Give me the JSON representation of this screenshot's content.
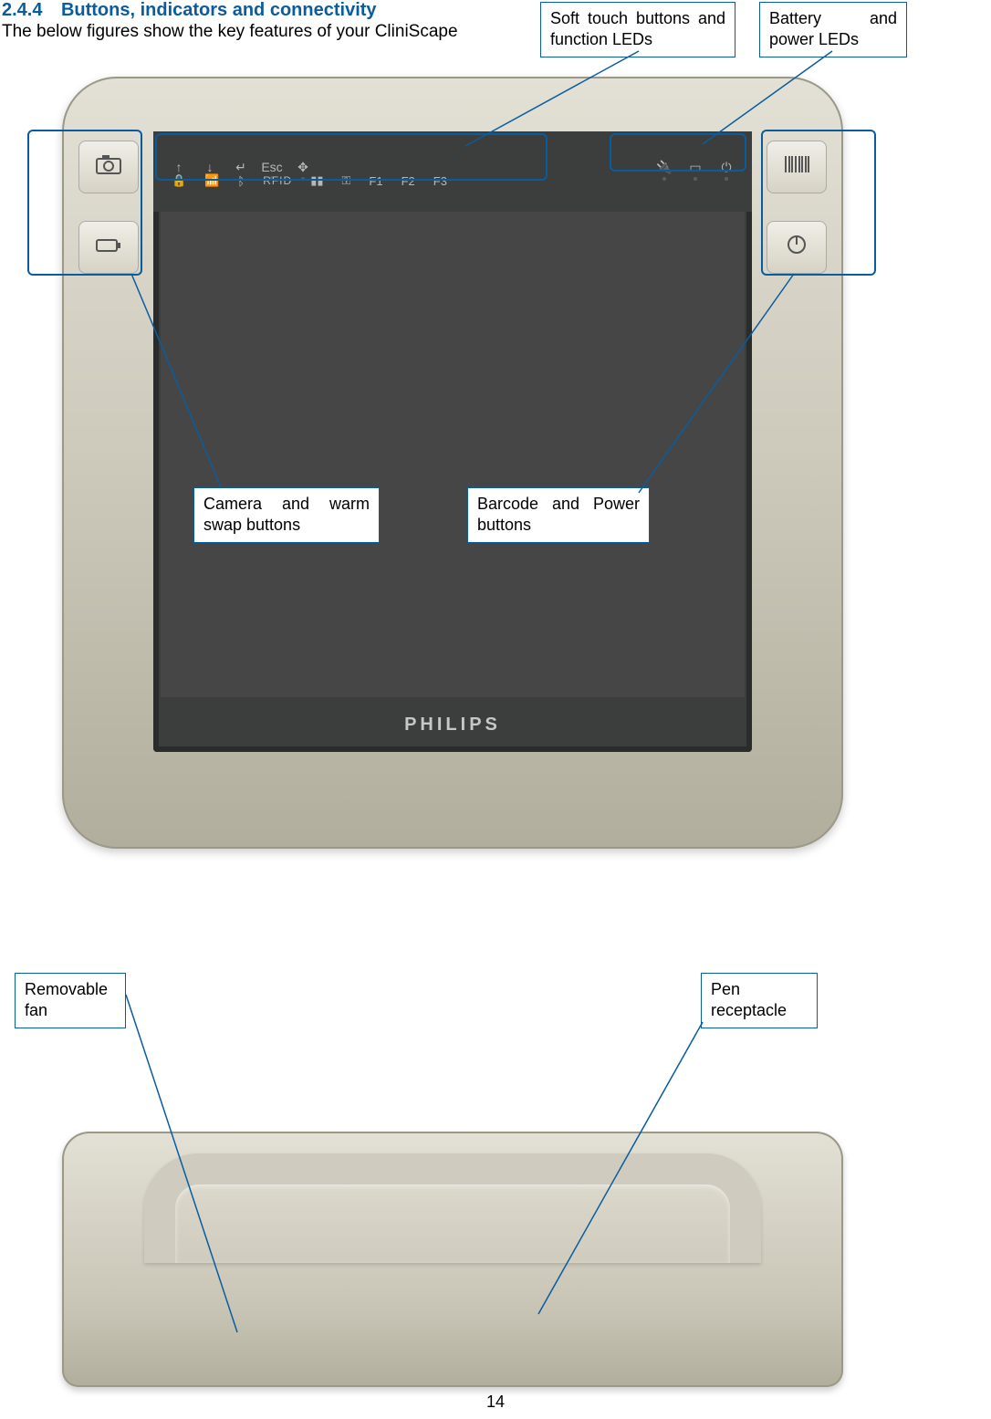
{
  "heading": {
    "number": "2.4.4",
    "title": "Buttons, indicators and connectivity"
  },
  "intro": "The below figures show the key features of your CliniScape",
  "callouts": {
    "soft_touch": "Soft touch buttons and function LEDs",
    "battery": "Battery and power LEDs",
    "camera": "Camera and warm swap buttons",
    "barcode": "Barcode and Power buttons",
    "fan": "Removable fan",
    "pen": "Pen receptacle"
  },
  "device": {
    "brand": "PHILIPS",
    "topbar": {
      "esc": "Esc",
      "f1": "F1",
      "f2": "F2",
      "f3": "F3",
      "rfid": "RFID"
    },
    "icons": {
      "camera": "camera-icon",
      "swap": "battery-swap-icon",
      "barcode": "barcode-icon",
      "power": "power-icon",
      "lock": "lock-icon",
      "wifi": "wifi-icon",
      "bluetooth": "bluetooth-icon",
      "key": "key-icon",
      "up": "arrow-up-icon",
      "down": "arrow-down-icon",
      "enter": "enter-icon",
      "move": "move-icon",
      "plug": "plug-icon",
      "batt": "battery-icon",
      "pwr_small": "power-small-icon"
    }
  },
  "page_number": "14"
}
